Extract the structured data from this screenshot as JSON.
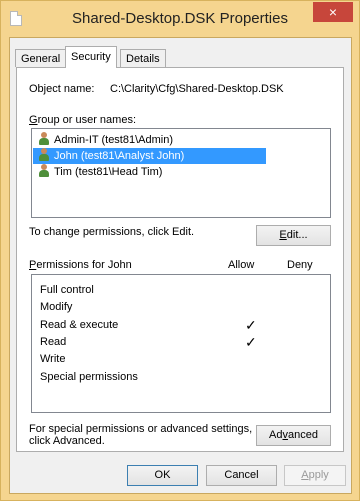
{
  "window": {
    "title": "Shared-Desktop.DSK Properties",
    "close_glyph": "×",
    "accent_color": "#f5d58f"
  },
  "tabs": [
    {
      "label": "General",
      "active": false
    },
    {
      "label": "Security",
      "active": true
    },
    {
      "label": "Details",
      "active": false
    }
  ],
  "object": {
    "label": "Object name:",
    "value": "C:\\Clarity\\Cfg\\Shared-Desktop.DSK"
  },
  "groups": {
    "label_prefix": "",
    "label_access": "G",
    "label_rest": "roup or user names:",
    "items": [
      {
        "name": "Admin-IT (test81\\Admin)",
        "selected": false,
        "icon": "user-icon"
      },
      {
        "name": "John (test81\\Analyst John)",
        "selected": true,
        "icon": "user-icon"
      },
      {
        "name": "Tim (test81\\Head Tim)",
        "selected": false,
        "icon": "user-icon"
      }
    ]
  },
  "change": {
    "text": "To change permissions, click Edit.",
    "edit_access": "E",
    "edit_rest": "dit..."
  },
  "permissions": {
    "title_access": "P",
    "title_rest": "ermissions for John",
    "allow_header": "Allow",
    "deny_header": "Deny",
    "rows": [
      {
        "name": "Full control",
        "allow": false,
        "deny": false
      },
      {
        "name": "Modify",
        "allow": false,
        "deny": false
      },
      {
        "name": "Read & execute",
        "allow": true,
        "deny": false
      },
      {
        "name": "Read",
        "allow": true,
        "deny": false
      },
      {
        "name": "Write",
        "allow": false,
        "deny": false
      },
      {
        "name": "Special permissions",
        "allow": false,
        "deny": false
      }
    ],
    "check_glyph": "✓"
  },
  "advanced": {
    "text_line1": "For special permissions or advanced settings,",
    "text_line2": "click Advanced.",
    "button_before": "Ad",
    "button_access": "v",
    "button_after": "anced"
  },
  "footer": {
    "ok_label": "OK",
    "cancel_label": "Cancel",
    "apply_access": "A",
    "apply_rest": "pply"
  }
}
